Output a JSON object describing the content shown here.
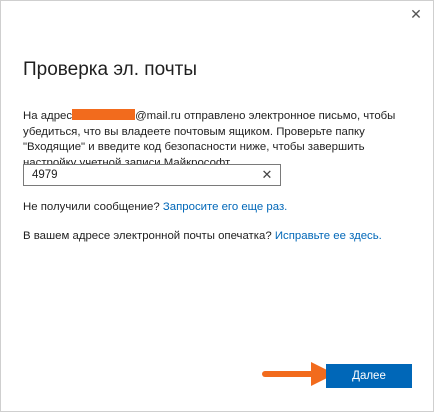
{
  "window": {
    "close_icon": "close-icon",
    "close_glyph": "✕"
  },
  "title": "Проверка эл. почты",
  "description": {
    "prefix": "На адрес",
    "suffix": "@mail.ru отправлено электронное письмо, чтобы убедиться, что вы владеете почтовым ящиком. Проверьте папку \"Входящие\" и введите код безопасности ниже, чтобы завершить настройку учетной записи Майкрософт."
  },
  "code_input": {
    "value": "4979",
    "clear_glyph": "✕"
  },
  "no_message": {
    "text": "Не получили сообщение?",
    "link": "Запросите его еще раз."
  },
  "typo": {
    "text": "В вашем адресе электронной почты опечатка?",
    "link": "Исправьте ее здесь."
  },
  "next_button": {
    "label": "Далее"
  },
  "colors": {
    "accent": "#0067b8",
    "redaction": "#f26b1d",
    "arrow": "#f26b1d"
  }
}
